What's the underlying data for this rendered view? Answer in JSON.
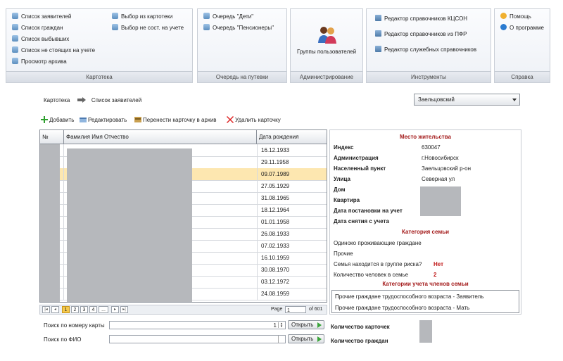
{
  "ribbon": {
    "kartoteka": {
      "items_col1": [
        "Список заявителей",
        "Список граждан",
        "Список выбывших",
        "Список не стоящих на учете",
        "Просмотр архива"
      ],
      "items_col2": [
        "Выбор из картотеки",
        "Выбор не сост. на учете"
      ],
      "footer": "Картотека"
    },
    "queue": {
      "items": [
        "Очередь \"Дети\"",
        "Очередь \"Пенсионеры\""
      ],
      "footer": "Очередь на путевки"
    },
    "admin": {
      "button_label": "Группы пользователей",
      "footer": "Администрирование"
    },
    "tools": {
      "items": [
        "Редактор справочников КЦСОН",
        "Редактор справочников из ПФР",
        "Редактор служебных справочников"
      ],
      "footer": "Инструменты"
    },
    "help": {
      "items": [
        "Помощь",
        "О программе"
      ],
      "footer": "Справка"
    }
  },
  "breadcrumb": {
    "root": "Картотека",
    "current": "Список заявителей"
  },
  "district_select": {
    "value": "Заельцовский"
  },
  "toolbar": {
    "add": "Добавить",
    "edit": "Редактировать",
    "archive": "Перенести карточку в архив",
    "delete": "Удалить карточку"
  },
  "grid": {
    "columns": [
      "№",
      "Фамилия Имя Отчество",
      "Дата рождения"
    ],
    "dates": [
      "16.12.1933",
      "29.11.1958",
      "09.07.1989",
      "27.05.1929",
      "31.08.1965",
      "18.12.1964",
      "01.01.1958",
      "26.08.1933",
      "07.02.1933",
      "16.10.1959",
      "30.08.1970",
      "03.12.1972",
      "24.08.1959"
    ],
    "selected_index": 2
  },
  "pager": {
    "pages": [
      "1",
      "2",
      "3",
      "4",
      "..."
    ],
    "page_label": "Page",
    "page_value": "1",
    "of_label": "of 601"
  },
  "details": {
    "residence_title": "Место жительства",
    "fields": [
      {
        "label": "Индекс",
        "value": "630047"
      },
      {
        "label": "Администрация",
        "value": "г.Новосибирск"
      },
      {
        "label": "Населенный пункт",
        "value": "Заельцовский р-он"
      },
      {
        "label": "Улица",
        "value": "Северная ул"
      },
      {
        "label": "Дом",
        "value": ""
      },
      {
        "label": "Квартира",
        "value": ""
      },
      {
        "label": "Дата постановки на учет",
        "value": ""
      },
      {
        "label": "Дата снятия с учета",
        "value": ""
      }
    ],
    "family_title": "Категория семьи",
    "family_lines": [
      "Одиноко проживающие граждане",
      "Прочие"
    ],
    "risk_label": "Семья находится в группе риска?",
    "risk_value": "Нет",
    "count_label": "Количество человек в семье",
    "count_value": "2",
    "members_title": "Категории учета членов семьи",
    "members": [
      "Прочие граждане трудоспособного возраста - Заявитель",
      "Прочие граждане трудоспособного возраста - Мать"
    ]
  },
  "search": {
    "card_label": "Поиск по номеру карты",
    "card_value": "1",
    "fio_label": "Поиск по ФИО",
    "open_label": "Открыть"
  },
  "summary": {
    "cards_label": "Количество карточек",
    "citizens_label": "Количество граждан"
  }
}
